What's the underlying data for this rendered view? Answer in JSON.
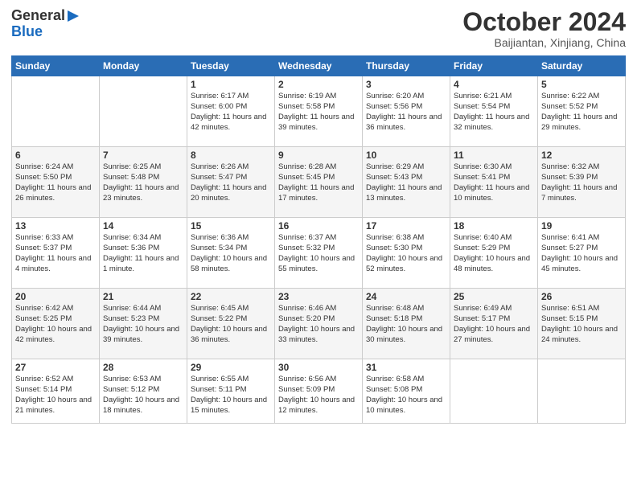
{
  "header": {
    "logo_line1": "General",
    "logo_line2": "Blue",
    "title": "October 2024",
    "subtitle": "Baijiantan, Xinjiang, China"
  },
  "days_of_week": [
    "Sunday",
    "Monday",
    "Tuesday",
    "Wednesday",
    "Thursday",
    "Friday",
    "Saturday"
  ],
  "weeks": [
    [
      {
        "day": "",
        "info": ""
      },
      {
        "day": "",
        "info": ""
      },
      {
        "day": "1",
        "info": "Sunrise: 6:17 AM\nSunset: 6:00 PM\nDaylight: 11 hours and 42 minutes."
      },
      {
        "day": "2",
        "info": "Sunrise: 6:19 AM\nSunset: 5:58 PM\nDaylight: 11 hours and 39 minutes."
      },
      {
        "day": "3",
        "info": "Sunrise: 6:20 AM\nSunset: 5:56 PM\nDaylight: 11 hours and 36 minutes."
      },
      {
        "day": "4",
        "info": "Sunrise: 6:21 AM\nSunset: 5:54 PM\nDaylight: 11 hours and 32 minutes."
      },
      {
        "day": "5",
        "info": "Sunrise: 6:22 AM\nSunset: 5:52 PM\nDaylight: 11 hours and 29 minutes."
      }
    ],
    [
      {
        "day": "6",
        "info": "Sunrise: 6:24 AM\nSunset: 5:50 PM\nDaylight: 11 hours and 26 minutes."
      },
      {
        "day": "7",
        "info": "Sunrise: 6:25 AM\nSunset: 5:48 PM\nDaylight: 11 hours and 23 minutes."
      },
      {
        "day": "8",
        "info": "Sunrise: 6:26 AM\nSunset: 5:47 PM\nDaylight: 11 hours and 20 minutes."
      },
      {
        "day": "9",
        "info": "Sunrise: 6:28 AM\nSunset: 5:45 PM\nDaylight: 11 hours and 17 minutes."
      },
      {
        "day": "10",
        "info": "Sunrise: 6:29 AM\nSunset: 5:43 PM\nDaylight: 11 hours and 13 minutes."
      },
      {
        "day": "11",
        "info": "Sunrise: 6:30 AM\nSunset: 5:41 PM\nDaylight: 11 hours and 10 minutes."
      },
      {
        "day": "12",
        "info": "Sunrise: 6:32 AM\nSunset: 5:39 PM\nDaylight: 11 hours and 7 minutes."
      }
    ],
    [
      {
        "day": "13",
        "info": "Sunrise: 6:33 AM\nSunset: 5:37 PM\nDaylight: 11 hours and 4 minutes."
      },
      {
        "day": "14",
        "info": "Sunrise: 6:34 AM\nSunset: 5:36 PM\nDaylight: 11 hours and 1 minute."
      },
      {
        "day": "15",
        "info": "Sunrise: 6:36 AM\nSunset: 5:34 PM\nDaylight: 10 hours and 58 minutes."
      },
      {
        "day": "16",
        "info": "Sunrise: 6:37 AM\nSunset: 5:32 PM\nDaylight: 10 hours and 55 minutes."
      },
      {
        "day": "17",
        "info": "Sunrise: 6:38 AM\nSunset: 5:30 PM\nDaylight: 10 hours and 52 minutes."
      },
      {
        "day": "18",
        "info": "Sunrise: 6:40 AM\nSunset: 5:29 PM\nDaylight: 10 hours and 48 minutes."
      },
      {
        "day": "19",
        "info": "Sunrise: 6:41 AM\nSunset: 5:27 PM\nDaylight: 10 hours and 45 minutes."
      }
    ],
    [
      {
        "day": "20",
        "info": "Sunrise: 6:42 AM\nSunset: 5:25 PM\nDaylight: 10 hours and 42 minutes."
      },
      {
        "day": "21",
        "info": "Sunrise: 6:44 AM\nSunset: 5:23 PM\nDaylight: 10 hours and 39 minutes."
      },
      {
        "day": "22",
        "info": "Sunrise: 6:45 AM\nSunset: 5:22 PM\nDaylight: 10 hours and 36 minutes."
      },
      {
        "day": "23",
        "info": "Sunrise: 6:46 AM\nSunset: 5:20 PM\nDaylight: 10 hours and 33 minutes."
      },
      {
        "day": "24",
        "info": "Sunrise: 6:48 AM\nSunset: 5:18 PM\nDaylight: 10 hours and 30 minutes."
      },
      {
        "day": "25",
        "info": "Sunrise: 6:49 AM\nSunset: 5:17 PM\nDaylight: 10 hours and 27 minutes."
      },
      {
        "day": "26",
        "info": "Sunrise: 6:51 AM\nSunset: 5:15 PM\nDaylight: 10 hours and 24 minutes."
      }
    ],
    [
      {
        "day": "27",
        "info": "Sunrise: 6:52 AM\nSunset: 5:14 PM\nDaylight: 10 hours and 21 minutes."
      },
      {
        "day": "28",
        "info": "Sunrise: 6:53 AM\nSunset: 5:12 PM\nDaylight: 10 hours and 18 minutes."
      },
      {
        "day": "29",
        "info": "Sunrise: 6:55 AM\nSunset: 5:11 PM\nDaylight: 10 hours and 15 minutes."
      },
      {
        "day": "30",
        "info": "Sunrise: 6:56 AM\nSunset: 5:09 PM\nDaylight: 10 hours and 12 minutes."
      },
      {
        "day": "31",
        "info": "Sunrise: 6:58 AM\nSunset: 5:08 PM\nDaylight: 10 hours and 10 minutes."
      },
      {
        "day": "",
        "info": ""
      },
      {
        "day": "",
        "info": ""
      }
    ]
  ]
}
